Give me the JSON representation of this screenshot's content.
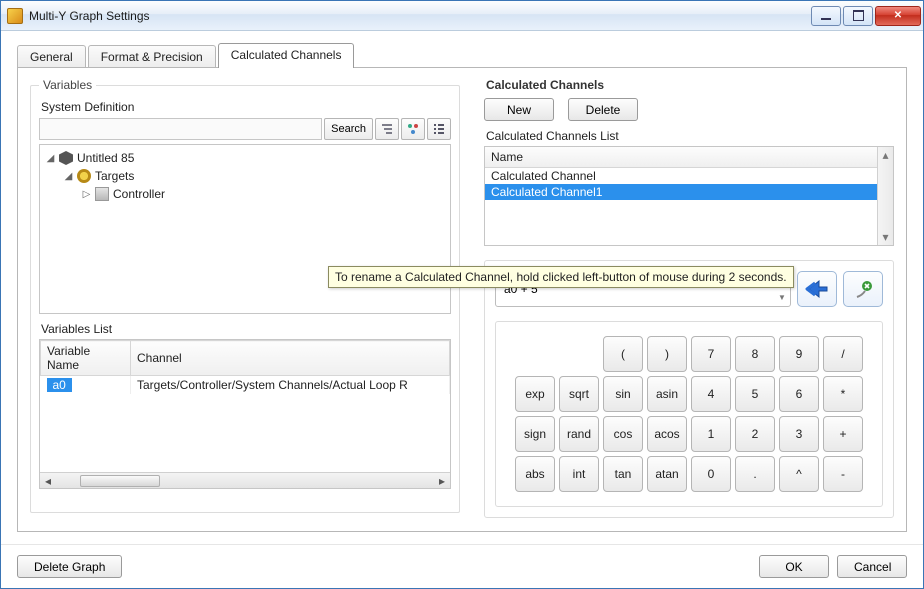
{
  "window": {
    "title": "Multi-Y Graph Settings"
  },
  "tabs": [
    "General",
    "Format & Precision",
    "Calculated Channels"
  ],
  "active_tab": 2,
  "left": {
    "group_title": "Variables",
    "sysdef_label": "System Definition",
    "search_btn": "Search",
    "tree": {
      "root": "Untitled 85",
      "targets": "Targets",
      "controller": "Controller"
    },
    "vars_list_label": "Variables List",
    "grid": {
      "cols": [
        "Variable Name",
        "Channel"
      ],
      "rows": [
        {
          "var": "a0",
          "channel": "Targets/Controller/System Channels/Actual Loop R"
        }
      ]
    }
  },
  "right": {
    "header": "Calculated Channels",
    "new_btn": "New",
    "delete_btn": "Delete",
    "list_label": "Calculated Channels List",
    "list_header": "Name",
    "items": [
      "Calculated Channel",
      "Calculated Channel1"
    ],
    "selected_index": 1,
    "tooltip": "To rename a Calculated Channel, hold clicked left-button of mouse during 2 seconds.",
    "expression": "a0 + 5",
    "keypad": [
      [
        "",
        "",
        "(",
        ")",
        "7",
        "8",
        "9",
        "/"
      ],
      [
        "exp",
        "sqrt",
        "sin",
        "asin",
        "4",
        "5",
        "6",
        "*"
      ],
      [
        "sign",
        "rand",
        "cos",
        "acos",
        "1",
        "2",
        "3",
        "+"
      ],
      [
        "abs",
        "int",
        "tan",
        "atan",
        "0",
        ".",
        "^",
        "-"
      ]
    ]
  },
  "footer": {
    "delete_graph": "Delete Graph",
    "ok": "OK",
    "cancel": "Cancel"
  }
}
